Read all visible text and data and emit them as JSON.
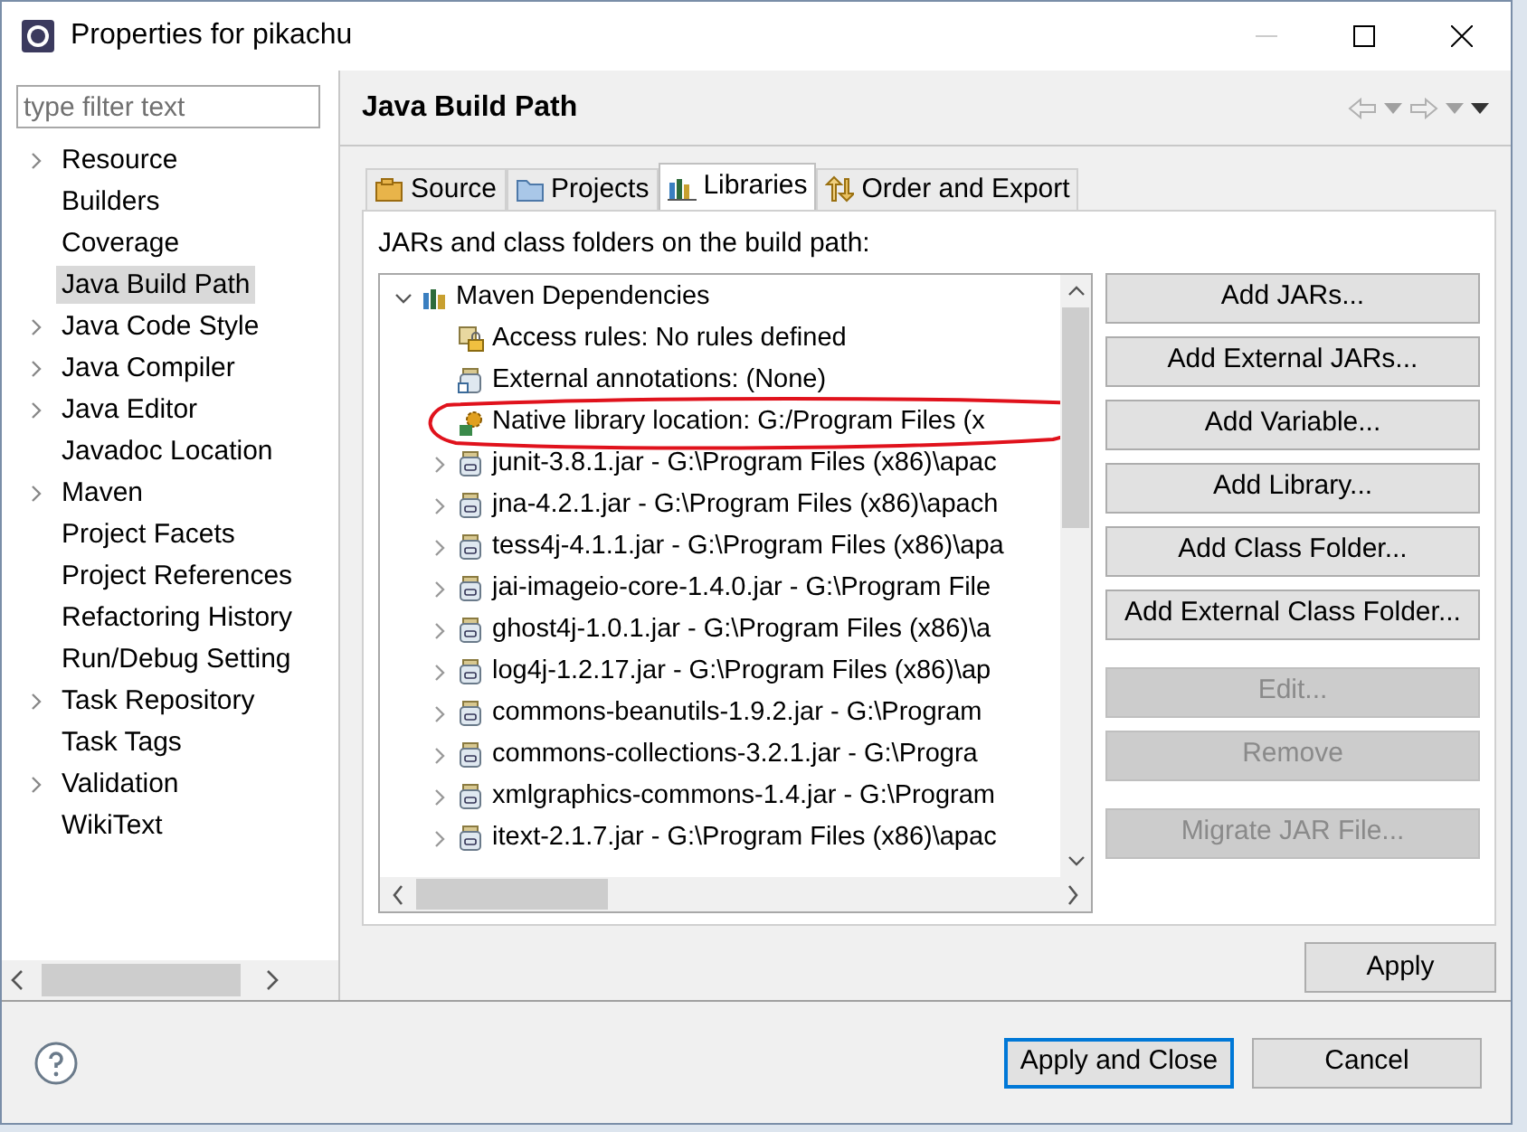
{
  "window": {
    "title": "Properties for pikachu"
  },
  "filter": {
    "placeholder": "type filter text"
  },
  "sidebar": {
    "items": [
      {
        "label": "Resource",
        "kind": "group",
        "selected": false
      },
      {
        "label": "Builders",
        "kind": "leaf",
        "selected": false
      },
      {
        "label": "Coverage",
        "kind": "leaf",
        "selected": false
      },
      {
        "label": "Java Build Path",
        "kind": "leaf",
        "selected": true
      },
      {
        "label": "Java Code Style",
        "kind": "group",
        "selected": false
      },
      {
        "label": "Java Compiler",
        "kind": "group",
        "selected": false
      },
      {
        "label": "Java Editor",
        "kind": "group",
        "selected": false
      },
      {
        "label": "Javadoc Location",
        "kind": "leaf",
        "selected": false
      },
      {
        "label": "Maven",
        "kind": "group",
        "selected": false
      },
      {
        "label": "Project Facets",
        "kind": "leaf",
        "selected": false
      },
      {
        "label": "Project References",
        "kind": "leaf",
        "selected": false
      },
      {
        "label": "Refactoring History",
        "kind": "leaf",
        "selected": false
      },
      {
        "label": "Run/Debug Setting",
        "kind": "leaf",
        "selected": false
      },
      {
        "label": "Task Repository",
        "kind": "group",
        "selected": false
      },
      {
        "label": "Task Tags",
        "kind": "leaf",
        "selected": false
      },
      {
        "label": "Validation",
        "kind": "group",
        "selected": false
      },
      {
        "label": "WikiText",
        "kind": "leaf",
        "selected": false
      }
    ]
  },
  "page": {
    "title": "Java Build Path"
  },
  "tabs": [
    {
      "label": "Source",
      "kind": "source",
      "selected": false
    },
    {
      "label": "Projects",
      "kind": "projects",
      "selected": false
    },
    {
      "label": "Libraries",
      "kind": "libraries",
      "selected": true
    },
    {
      "label": "Order and Export",
      "kind": "order",
      "selected": false
    }
  ],
  "libraries": {
    "caption": "JARs and class folders on the build path:",
    "tree": [
      {
        "label": "Maven Dependencies",
        "kind": "container",
        "expanded": true,
        "children": [
          {
            "label": "Access rules: No rules defined",
            "kind": "rules",
            "highlighted": false
          },
          {
            "label": "External annotations: (None)",
            "kind": "annotations",
            "highlighted": false
          },
          {
            "label": "Native library location: G:/Program Files (x",
            "kind": "native",
            "highlighted": true
          },
          {
            "label": "junit-3.8.1.jar - G:\\Program Files (x86)\\apac",
            "kind": "jar",
            "expanded": false
          },
          {
            "label": "jna-4.2.1.jar - G:\\Program Files (x86)\\apach",
            "kind": "jar",
            "expanded": false
          },
          {
            "label": "tess4j-4.1.1.jar - G:\\Program Files (x86)\\apa",
            "kind": "jar",
            "expanded": false
          },
          {
            "label": "jai-imageio-core-1.4.0.jar - G:\\Program File",
            "kind": "jar",
            "expanded": false
          },
          {
            "label": "ghost4j-1.0.1.jar - G:\\Program Files (x86)\\a",
            "kind": "jar",
            "expanded": false
          },
          {
            "label": "log4j-1.2.17.jar - G:\\Program Files (x86)\\ap",
            "kind": "jar",
            "expanded": false
          },
          {
            "label": "commons-beanutils-1.9.2.jar - G:\\Program",
            "kind": "jar",
            "expanded": false
          },
          {
            "label": "commons-collections-3.2.1.jar - G:\\Progra",
            "kind": "jar",
            "expanded": false
          },
          {
            "label": "xmlgraphics-commons-1.4.jar - G:\\Program",
            "kind": "jar",
            "expanded": false
          },
          {
            "label": "itext-2.1.7.jar - G:\\Program Files (x86)\\apac",
            "kind": "jar",
            "expanded": false
          }
        ]
      }
    ],
    "buttons": [
      {
        "label": "Add JARs...",
        "disabled": false,
        "spaced": false
      },
      {
        "label": "Add External JARs...",
        "disabled": false,
        "spaced": false
      },
      {
        "label": "Add Variable...",
        "disabled": false,
        "spaced": false
      },
      {
        "label": "Add Library...",
        "disabled": false,
        "spaced": false
      },
      {
        "label": "Add Class Folder...",
        "disabled": false,
        "spaced": false
      },
      {
        "label": "Add External Class Folder...",
        "disabled": false,
        "spaced": false
      },
      {
        "label": "Edit...",
        "disabled": true,
        "spaced": true
      },
      {
        "label": "Remove",
        "disabled": true,
        "spaced": false
      },
      {
        "label": "Migrate JAR File...",
        "disabled": true,
        "spaced": true
      }
    ]
  },
  "apply_button": {
    "label": "Apply"
  },
  "footer_buttons": [
    {
      "label": "Apply and Close",
      "default": true
    },
    {
      "label": "Cancel",
      "default": false
    }
  ]
}
